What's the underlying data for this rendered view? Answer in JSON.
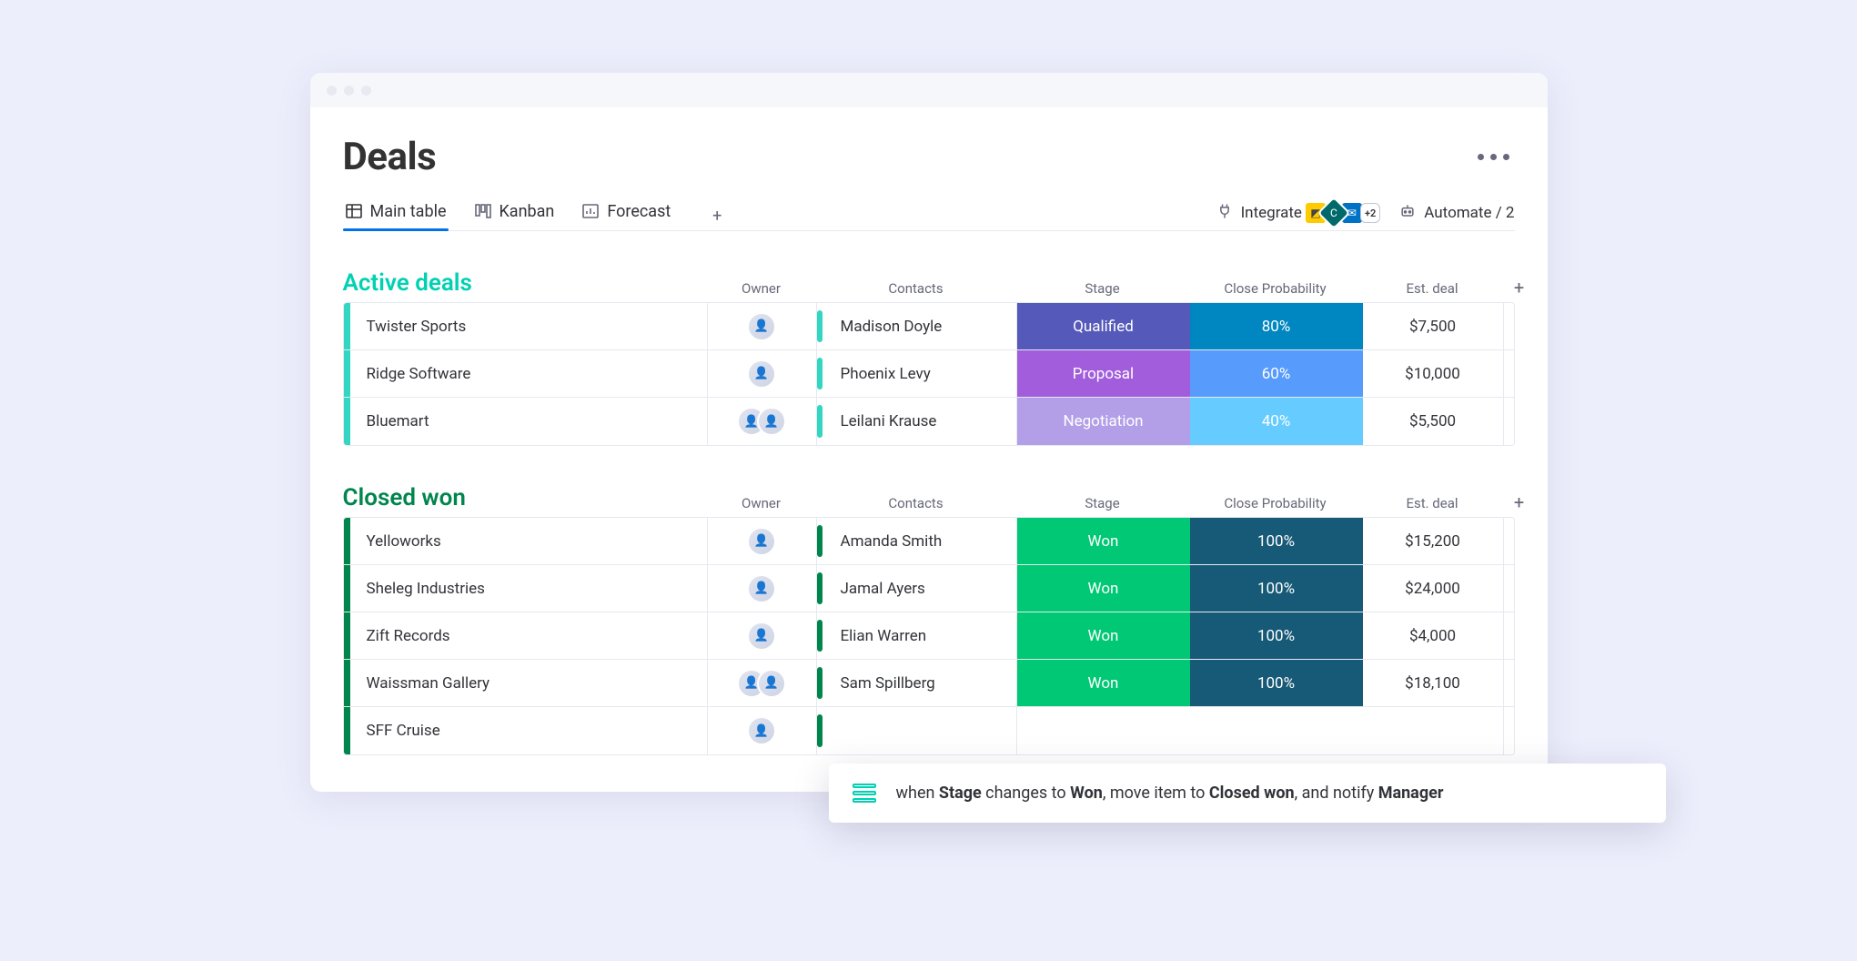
{
  "page": {
    "title": "Deals"
  },
  "tabs": [
    {
      "label": "Main table",
      "active": true
    },
    {
      "label": "Kanban",
      "active": false
    },
    {
      "label": "Forecast",
      "active": false
    }
  ],
  "toolbar": {
    "integrate": "Integrate",
    "integrate_more": "+2",
    "automate": "Automate / 2"
  },
  "columns": {
    "owner": "Owner",
    "contacts": "Contacts",
    "stage": "Stage",
    "probability": "Close Probability",
    "est": "Est. deal"
  },
  "groups": [
    {
      "id": "active",
      "title": "Active deals",
      "rows": [
        {
          "name": "Twister Sports",
          "owner_count": 1,
          "contact": "Madison Doyle",
          "stage": "Qualified",
          "stage_class": "stage-qualified",
          "prob": "80%",
          "prob_class": "prob-80",
          "est": "$7,500"
        },
        {
          "name": "Ridge Software",
          "owner_count": 1,
          "contact": "Phoenix Levy",
          "stage": "Proposal",
          "stage_class": "stage-proposal",
          "prob": "60%",
          "prob_class": "prob-60",
          "est": "$10,000"
        },
        {
          "name": "Bluemart",
          "owner_count": 2,
          "contact": "Leilani Krause",
          "stage": "Negotiation",
          "stage_class": "stage-negotiation",
          "prob": "40%",
          "prob_class": "prob-40",
          "est": "$5,500"
        }
      ]
    },
    {
      "id": "won",
      "title": "Closed won",
      "rows": [
        {
          "name": "Yelloworks",
          "owner_count": 1,
          "contact": "Amanda Smith",
          "stage": "Won",
          "stage_class": "stage-won",
          "prob": "100%",
          "prob_class": "prob-100",
          "est": "$15,200"
        },
        {
          "name": "Sheleg Industries",
          "owner_count": 1,
          "contact": "Jamal Ayers",
          "stage": "Won",
          "stage_class": "stage-won",
          "prob": "100%",
          "prob_class": "prob-100",
          "est": "$24,000"
        },
        {
          "name": "Zift Records",
          "owner_count": 1,
          "contact": "Elian Warren",
          "stage": "Won",
          "stage_class": "stage-won",
          "prob": "100%",
          "prob_class": "prob-100",
          "est": "$4,000"
        },
        {
          "name": "Waissman Gallery",
          "owner_count": 2,
          "contact": "Sam Spillberg",
          "stage": "Won",
          "stage_class": "stage-won",
          "prob": "100%",
          "prob_class": "prob-100",
          "est": "$18,100"
        },
        {
          "name": "SFF Cruise",
          "owner_count": 1,
          "contact": "",
          "stage": "",
          "stage_class": "",
          "prob": "",
          "prob_class": "",
          "est": ""
        }
      ]
    }
  ],
  "automation": {
    "pre": "when ",
    "b1": "Stage",
    "mid1": " changes to ",
    "b2": "Won",
    "mid2": ", move item to ",
    "b3": "Closed won",
    "mid3": ", and notify ",
    "b4": "Manager"
  }
}
